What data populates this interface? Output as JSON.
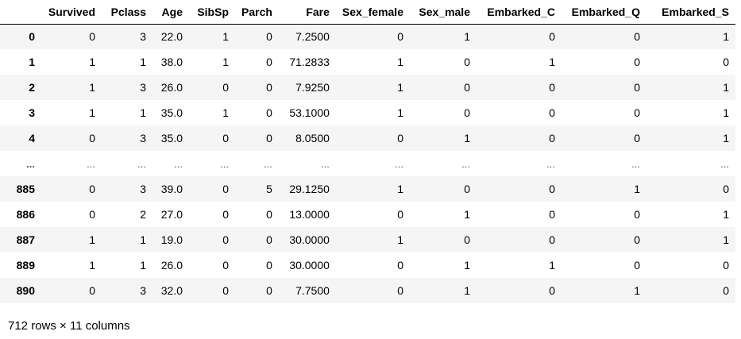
{
  "dataframe": {
    "columns": [
      "Survived",
      "Pclass",
      "Age",
      "SibSp",
      "Parch",
      "Fare",
      "Sex_female",
      "Sex_male",
      "Embarked_C",
      "Embarked_Q",
      "Embarked_S"
    ],
    "rows": [
      {
        "index": "0",
        "cells": [
          "0",
          "3",
          "22.0",
          "1",
          "0",
          "7.2500",
          "0",
          "1",
          "0",
          "0",
          "1"
        ]
      },
      {
        "index": "1",
        "cells": [
          "1",
          "1",
          "38.0",
          "1",
          "0",
          "71.2833",
          "1",
          "0",
          "1",
          "0",
          "0"
        ]
      },
      {
        "index": "2",
        "cells": [
          "1",
          "3",
          "26.0",
          "0",
          "0",
          "7.9250",
          "1",
          "0",
          "0",
          "0",
          "1"
        ]
      },
      {
        "index": "3",
        "cells": [
          "1",
          "1",
          "35.0",
          "1",
          "0",
          "53.1000",
          "1",
          "0",
          "0",
          "0",
          "1"
        ]
      },
      {
        "index": "4",
        "cells": [
          "0",
          "3",
          "35.0",
          "0",
          "0",
          "8.0500",
          "0",
          "1",
          "0",
          "0",
          "1"
        ]
      },
      {
        "index": "...",
        "cells": [
          "...",
          "...",
          "...",
          "...",
          "...",
          "...",
          "...",
          "...",
          "...",
          "...",
          "..."
        ]
      },
      {
        "index": "885",
        "cells": [
          "0",
          "3",
          "39.0",
          "0",
          "5",
          "29.1250",
          "1",
          "0",
          "0",
          "1",
          "0"
        ]
      },
      {
        "index": "886",
        "cells": [
          "0",
          "2",
          "27.0",
          "0",
          "0",
          "13.0000",
          "0",
          "1",
          "0",
          "0",
          "1"
        ]
      },
      {
        "index": "887",
        "cells": [
          "1",
          "1",
          "19.0",
          "0",
          "0",
          "30.0000",
          "1",
          "0",
          "0",
          "0",
          "1"
        ]
      },
      {
        "index": "889",
        "cells": [
          "1",
          "1",
          "26.0",
          "0",
          "0",
          "30.0000",
          "0",
          "1",
          "1",
          "0",
          "0"
        ]
      },
      {
        "index": "890",
        "cells": [
          "0",
          "3",
          "32.0",
          "0",
          "0",
          "7.7500",
          "0",
          "1",
          "0",
          "1",
          "0"
        ]
      }
    ],
    "shape_caption": "712 rows × 11 columns"
  },
  "colors": {
    "stripe": "#f5f5f5",
    "text": "#000000"
  }
}
